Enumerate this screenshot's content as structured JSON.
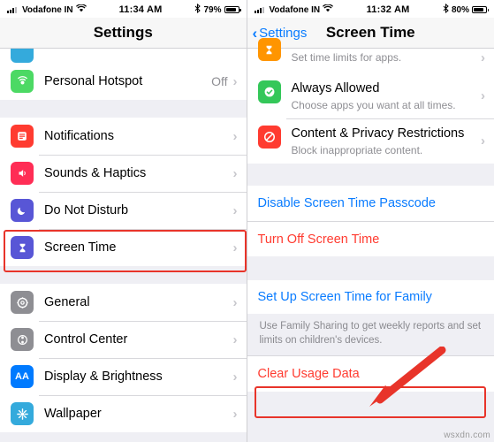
{
  "left_phone": {
    "status_bar": {
      "carrier": "Vodafone IN",
      "wifi_icon": "wifi-icon",
      "signal_icon": "signal-bars-icon",
      "time": "11:34 AM",
      "bluetooth_icon": "bluetooth-icon",
      "battery_percent": "79%",
      "battery_icon": "battery-icon"
    },
    "nav": {
      "title": "Settings"
    },
    "rows_group1": [
      {
        "label": "Personal Hotspot",
        "value": "Off",
        "icon": "hotspot-icon",
        "icon_color": "#4cd964",
        "glyph": "◉"
      }
    ],
    "rows_group2": [
      {
        "label": "Notifications",
        "value": "",
        "icon": "notifications-icon",
        "icon_color": "#ff3b30",
        "glyph": "▤"
      },
      {
        "label": "Sounds & Haptics",
        "value": "",
        "icon": "sounds-icon",
        "icon_color": "#ff2d55",
        "glyph": "◀))"
      },
      {
        "label": "Do Not Disturb",
        "value": "",
        "icon": "do-not-disturb-icon",
        "icon_color": "#5856d6",
        "glyph": "☾"
      },
      {
        "label": "Screen Time",
        "value": "",
        "icon": "screen-time-icon",
        "icon_color": "#5856d6",
        "glyph": "⧗"
      }
    ],
    "rows_group3": [
      {
        "label": "General",
        "value": "",
        "icon": "general-icon",
        "icon_color": "#8e8e93",
        "glyph": "⚙"
      },
      {
        "label": "Control Center",
        "value": "",
        "icon": "control-center-icon",
        "icon_color": "#8e8e93",
        "glyph": "◉"
      },
      {
        "label": "Display & Brightness",
        "value": "",
        "icon": "display-brightness-icon",
        "icon_color": "#007aff",
        "glyph": "AA"
      },
      {
        "label": "Wallpaper",
        "value": "",
        "icon": "wallpaper-icon",
        "icon_color": "#34aadc",
        "glyph": "✻"
      }
    ],
    "chevron": "›"
  },
  "right_phone": {
    "status_bar": {
      "carrier": "Vodafone IN",
      "wifi_icon": "wifi-icon",
      "signal_icon": "signal-bars-icon",
      "time": "11:32 AM",
      "bluetooth_icon": "bluetooth-icon",
      "battery_percent": "80%",
      "battery_icon": "battery-icon"
    },
    "nav": {
      "back_label": "Settings",
      "title": "Screen Time",
      "back_chevron": "‹"
    },
    "rows": [
      {
        "title": "",
        "sub": "Set time limits for apps.",
        "icon": "app-limits-icon",
        "icon_color": "#ff9500",
        "glyph": "⧖",
        "partial": true
      },
      {
        "title": "Always Allowed",
        "sub": "Choose apps you want at all times.",
        "icon": "always-allowed-icon",
        "icon_color": "#34c759",
        "glyph": "✓",
        "partial": false
      },
      {
        "title": "Content & Privacy Restrictions",
        "sub": "Block inappropriate content.",
        "icon": "content-privacy-icon",
        "icon_color": "#ff3b30",
        "glyph": "⊘",
        "partial": false
      }
    ],
    "actions": [
      {
        "label": "Disable Screen Time Passcode",
        "style": "blue"
      },
      {
        "label": "Turn Off Screen Time",
        "style": "red"
      }
    ],
    "family_action": {
      "label": "Set Up Screen Time for Family",
      "style": "blue"
    },
    "family_footnote": "Use Family Sharing to get weekly reports and set limits on children's devices.",
    "clear_action": {
      "label": "Clear Usage Data",
      "style": "red"
    },
    "chevron": "›"
  },
  "annotations": {
    "highlight_color": "#e8342a",
    "arrow_color": "#e8342a",
    "watermark": "wsxdn.com"
  }
}
